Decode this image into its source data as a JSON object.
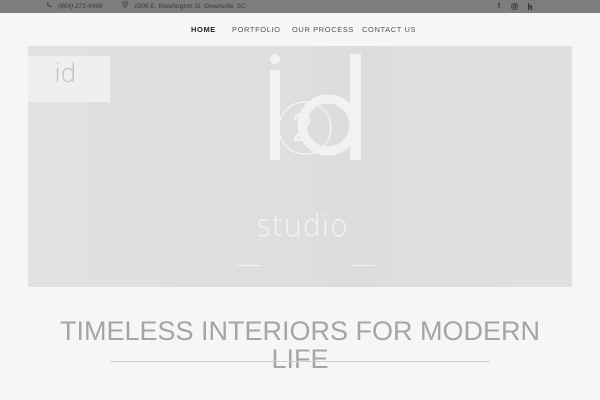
{
  "topbar": {
    "phone": "(864) 271-9498",
    "address": "1006 E. Washington St. Greenville, SC",
    "social": [
      "facebook-icon",
      "instagram-icon",
      "houzz-icon"
    ]
  },
  "nav": {
    "items": [
      {
        "label": "HOME",
        "active": true
      },
      {
        "label": "PORTFOLIO",
        "active": false
      },
      {
        "label": "OUR PROCESS",
        "active": false
      },
      {
        "label": "CONTACT US",
        "active": false
      }
    ]
  },
  "hero": {
    "logo_word": "studio",
    "small_logo": "id"
  },
  "headline": {
    "line1": "TIMELESS INTERIORS FOR MODERN",
    "line2": "LIFE"
  }
}
